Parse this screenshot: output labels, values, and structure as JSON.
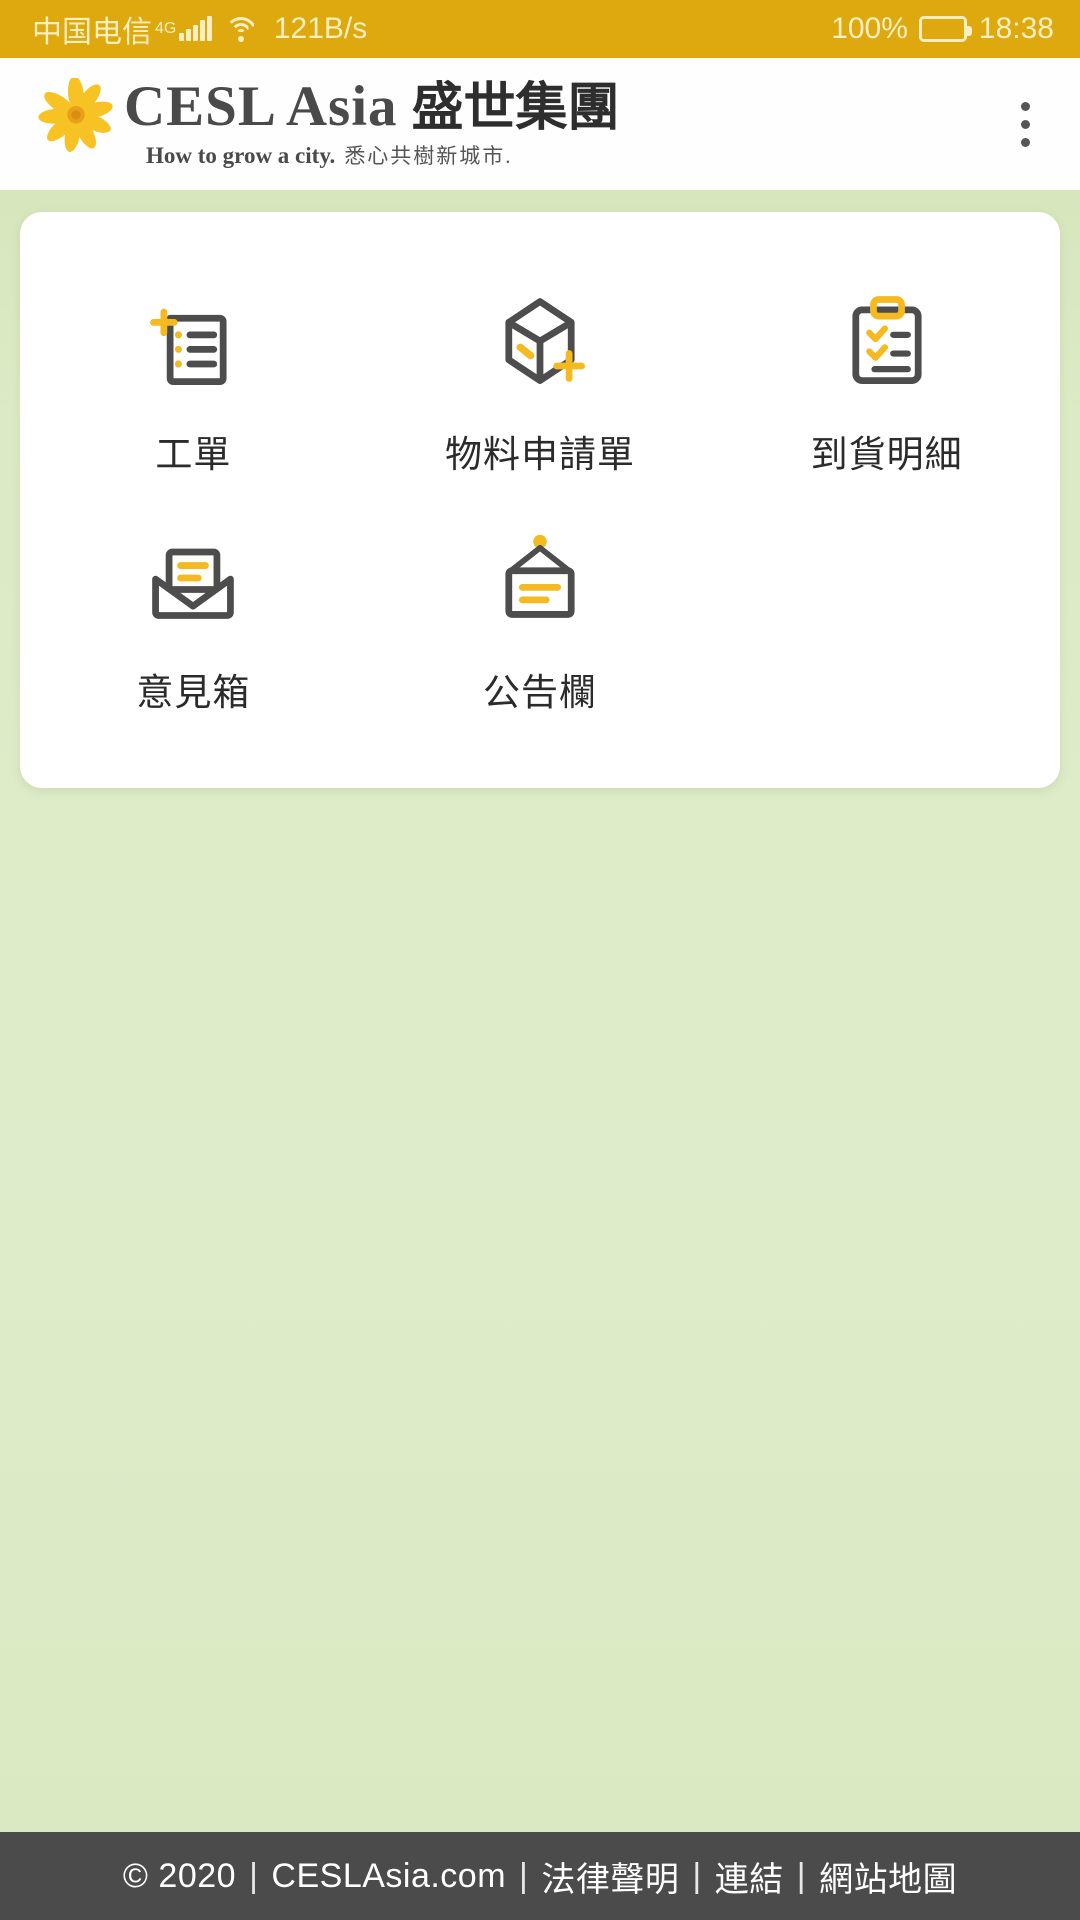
{
  "status_bar": {
    "carrier": "中国电信",
    "network_gen": "4G",
    "data_speed": "121B/s",
    "battery_percent": "100%",
    "clock": "18:38",
    "bg_color": "#dda90f",
    "fg_color": "#fbeec0",
    "signal_icon": "signal-bars-icon",
    "wifi_icon": "wifi-icon",
    "battery_icon": "battery-full-icon"
  },
  "header": {
    "logo_icon": "cesl-flower-logo-icon",
    "brand_en": "CESL Asia",
    "brand_zh": "盛世集團",
    "tagline_en": "How to grow a city.",
    "tagline_zh": "悉心共樹新城市.",
    "menu_icon": "overflow-menu-icon",
    "bg_color": "#fefefe"
  },
  "main": {
    "background_color": "#dfebc9",
    "card_background": "#ffffff",
    "accent_color": "#f5b921",
    "outline_color": "#4d4d4d",
    "tiles": [
      {
        "label": "工單",
        "icon": "work-order-icon",
        "name": "tile-work-order"
      },
      {
        "label": "物料申請單",
        "icon": "material-request-icon",
        "name": "tile-material-request"
      },
      {
        "label": "到貨明細",
        "icon": "delivery-details-icon",
        "name": "tile-delivery-details"
      },
      {
        "label": "意見箱",
        "icon": "feedback-box-icon",
        "name": "tile-feedback-box"
      },
      {
        "label": "公告欄",
        "icon": "bulletin-board-icon",
        "name": "tile-bulletin-board"
      }
    ]
  },
  "footer": {
    "copyright": "© 2020",
    "site": "CESLAsia.com",
    "links": [
      "法律聲明",
      "連結",
      "網站地圖"
    ],
    "separator": "|",
    "bg_color": "#4b4b4b"
  }
}
